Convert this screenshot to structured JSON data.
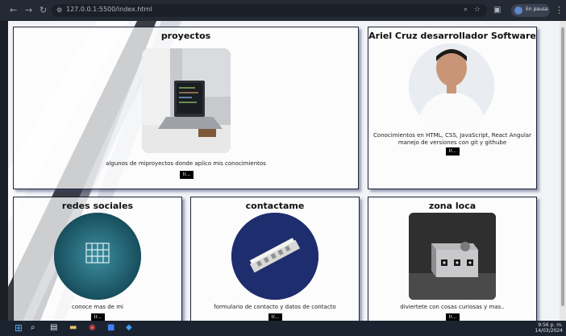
{
  "browser": {
    "url": "127.0.0.1:5500/index.html",
    "profile_label": "En pausa",
    "back_icon": "arrow-left-icon",
    "forward_icon": "arrow-right-icon",
    "reload_icon": "reload-icon"
  },
  "cards": {
    "proyectos": {
      "title": "proyectos",
      "desc": "algunos de miproyectos donde aplico mis conocimientos",
      "button": "Ir..."
    },
    "about": {
      "title": "Ariel Cruz desarrollador Software",
      "desc_line1": "Conocimientos en HTML, CSS, JavaScript, React Angular",
      "desc_line2": "manejo de versiones con git y githube",
      "button": "Ir..."
    },
    "redes": {
      "title": "redes sociales",
      "desc": "conoce mas de mi",
      "button": "Ir..."
    },
    "contacto": {
      "title": "contactame",
      "desc": "formulario de contacto y datos de contacto",
      "button": "Ir..."
    },
    "zona": {
      "title": "zona loca",
      "desc": "diviertete con cosas curiosas y mas..",
      "button": "Ir..."
    }
  },
  "taskbar": {
    "time": "9:56 p. m.",
    "date": "14/03/2024"
  },
  "colors": {
    "card_border": "#1f2436",
    "button_bg": "#000000",
    "page_bg": "#f2f3f7"
  }
}
